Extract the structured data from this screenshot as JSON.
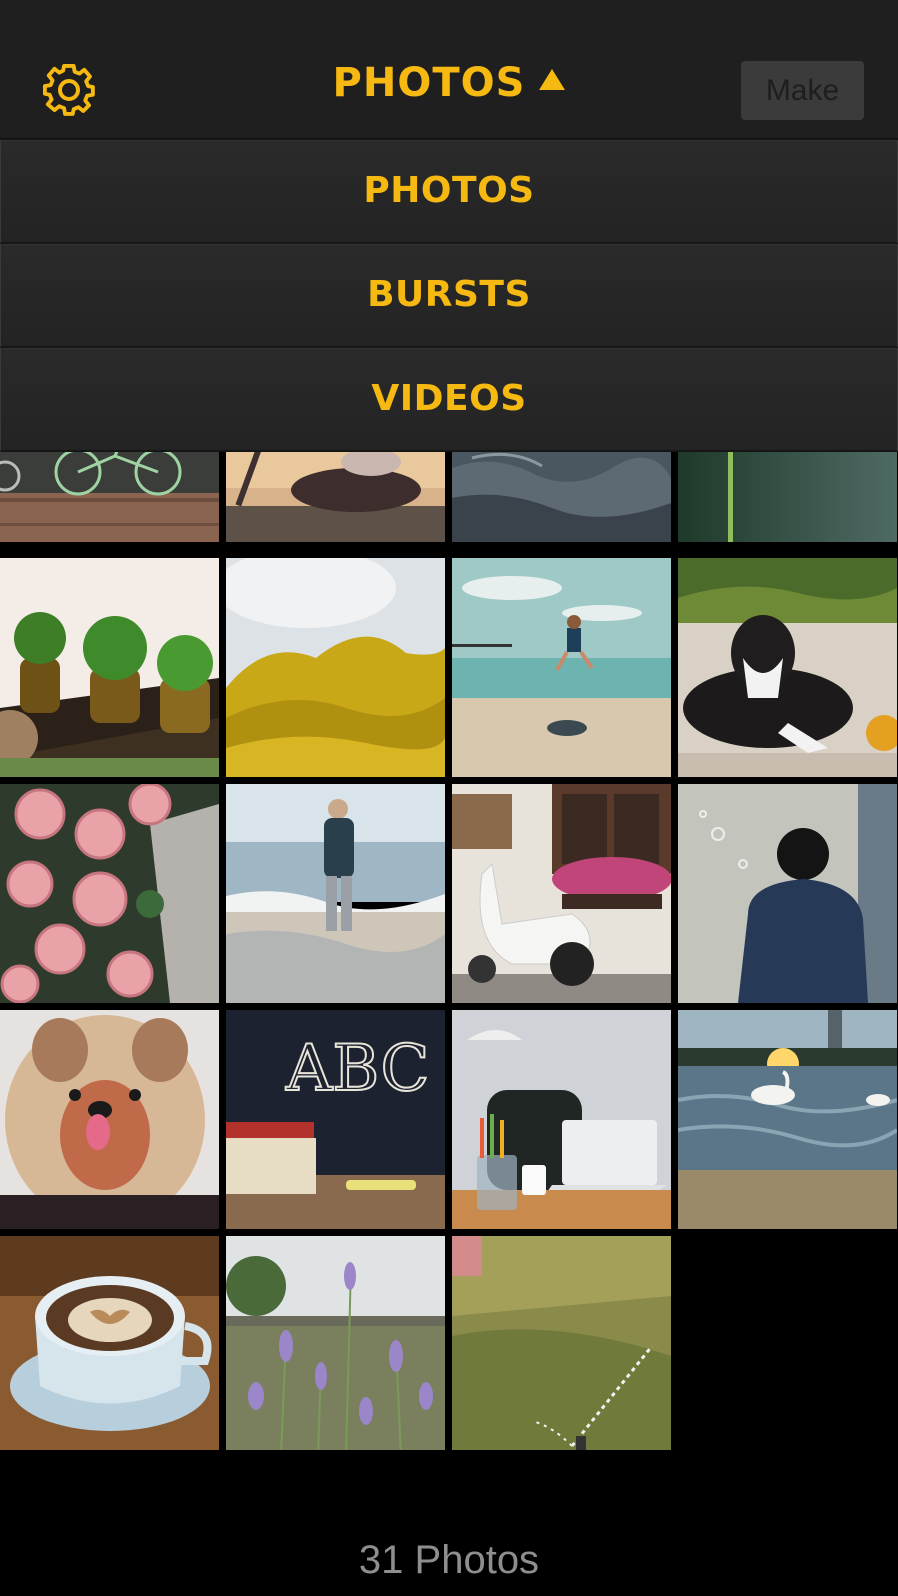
{
  "header": {
    "title": "PHOTOS",
    "make_label": "Make",
    "settings_icon": "gear-icon",
    "accent_color": "#f6b911"
  },
  "dropdown": {
    "items": [
      {
        "label": "PHOTOS"
      },
      {
        "label": "BURSTS"
      },
      {
        "label": "VIDEOS"
      }
    ]
  },
  "grid": {
    "partial_row": [
      {
        "subject": "bicycle"
      },
      {
        "subject": "person sitting"
      },
      {
        "subject": "water"
      },
      {
        "subject": "plant stem"
      }
    ],
    "rows": [
      [
        {
          "subject": "potted plants"
        },
        {
          "subject": "yellow shrub"
        },
        {
          "subject": "child jumping on beach"
        },
        {
          "subject": "puppy on sand"
        }
      ],
      [
        {
          "subject": "pink roses"
        },
        {
          "subject": "boy at sea"
        },
        {
          "subject": "scooter"
        },
        {
          "subject": "child with bubbles"
        }
      ],
      [
        {
          "subject": "dog"
        },
        {
          "subject": "ABC chalkboard"
        },
        {
          "subject": "desk with laptop"
        },
        {
          "subject": "swan at sunset"
        }
      ],
      [
        {
          "subject": "latte"
        },
        {
          "subject": "lavender"
        },
        {
          "subject": "sprinkler on grass"
        }
      ]
    ]
  },
  "footer": {
    "count_label": "31 Photos"
  }
}
